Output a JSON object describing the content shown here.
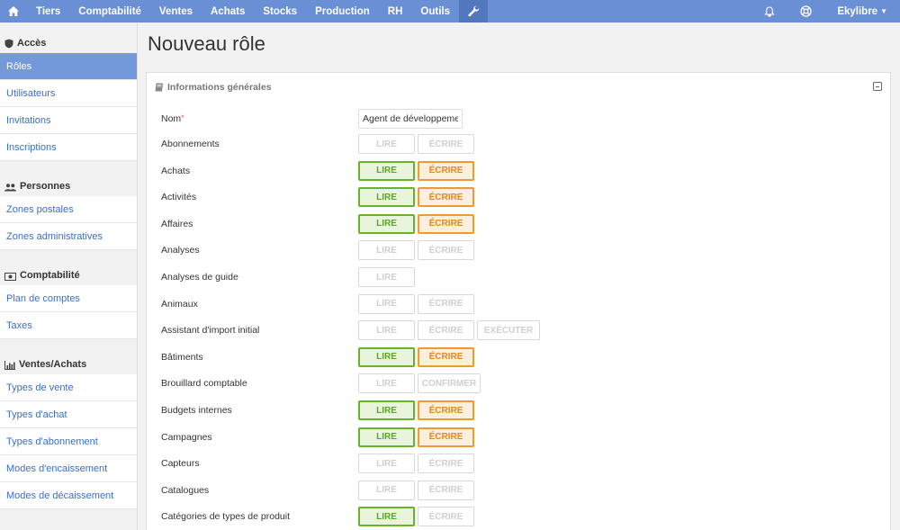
{
  "topnav": {
    "items": [
      "Tiers",
      "Comptabilité",
      "Ventes",
      "Achats",
      "Stocks",
      "Production",
      "RH",
      "Outils"
    ],
    "user": "Ekylibre"
  },
  "sidebar": {
    "sections": [
      {
        "title": "Accès",
        "icon": "shield-icon",
        "items": [
          "Rôles",
          "Utilisateurs",
          "Invitations",
          "Inscriptions"
        ]
      },
      {
        "title": "Personnes",
        "icon": "people-icon",
        "items": [
          "Zones postales",
          "Zones administratives"
        ]
      },
      {
        "title": "Comptabilité",
        "icon": "money-icon",
        "items": [
          "Plan de comptes",
          "Taxes"
        ]
      },
      {
        "title": "Ventes/Achats",
        "icon": "bar-chart-icon",
        "items": [
          "Types de vente",
          "Types d'achat",
          "Types d'abonnement",
          "Modes d'encaissement",
          "Modes de décaissement"
        ]
      }
    ]
  },
  "page": {
    "title": "Nouveau rôle"
  },
  "panel": {
    "title": "Informations générales",
    "name_label": "Nom",
    "name_required": "*",
    "name_value": "Agent de développement",
    "rows": [
      {
        "label": "Abonnements",
        "buttons": [
          {
            "text": "LIRE",
            "state": "off",
            "kind": "read"
          },
          {
            "text": "ÉCRIRE",
            "state": "off",
            "kind": "write"
          }
        ]
      },
      {
        "label": "Achats",
        "buttons": [
          {
            "text": "LIRE",
            "state": "on",
            "kind": "read"
          },
          {
            "text": "ÉCRIRE",
            "state": "on",
            "kind": "write"
          }
        ]
      },
      {
        "label": "Activités",
        "buttons": [
          {
            "text": "LIRE",
            "state": "on",
            "kind": "read"
          },
          {
            "text": "ÉCRIRE",
            "state": "on",
            "kind": "write"
          }
        ]
      },
      {
        "label": "Affaires",
        "buttons": [
          {
            "text": "LIRE",
            "state": "on",
            "kind": "read"
          },
          {
            "text": "ÉCRIRE",
            "state": "on",
            "kind": "write"
          }
        ]
      },
      {
        "label": "Analyses",
        "buttons": [
          {
            "text": "LIRE",
            "state": "off",
            "kind": "read"
          },
          {
            "text": "ÉCRIRE",
            "state": "off",
            "kind": "write"
          }
        ]
      },
      {
        "label": "Analyses de guide",
        "buttons": [
          {
            "text": "LIRE",
            "state": "off",
            "kind": "read"
          }
        ]
      },
      {
        "label": "Animaux",
        "buttons": [
          {
            "text": "LIRE",
            "state": "off",
            "kind": "read"
          },
          {
            "text": "ÉCRIRE",
            "state": "off",
            "kind": "write"
          }
        ]
      },
      {
        "label": "Assistant d'import initial",
        "buttons": [
          {
            "text": "LIRE",
            "state": "off",
            "kind": "read"
          },
          {
            "text": "ÉCRIRE",
            "state": "off",
            "kind": "write"
          },
          {
            "text": "EXÉCUTER",
            "state": "off",
            "kind": "execute"
          }
        ]
      },
      {
        "label": "Bâtiments",
        "buttons": [
          {
            "text": "LIRE",
            "state": "on",
            "kind": "read"
          },
          {
            "text": "ÉCRIRE",
            "state": "on",
            "kind": "write"
          }
        ]
      },
      {
        "label": "Brouillard comptable",
        "buttons": [
          {
            "text": "LIRE",
            "state": "off",
            "kind": "read"
          },
          {
            "text": "CONFIRMER",
            "state": "off",
            "kind": "confirm"
          }
        ]
      },
      {
        "label": "Budgets internes",
        "buttons": [
          {
            "text": "LIRE",
            "state": "on",
            "kind": "read"
          },
          {
            "text": "ÉCRIRE",
            "state": "on",
            "kind": "write"
          }
        ]
      },
      {
        "label": "Campagnes",
        "buttons": [
          {
            "text": "LIRE",
            "state": "on",
            "kind": "read"
          },
          {
            "text": "ÉCRIRE",
            "state": "on",
            "kind": "write"
          }
        ]
      },
      {
        "label": "Capteurs",
        "buttons": [
          {
            "text": "LIRE",
            "state": "off",
            "kind": "read"
          },
          {
            "text": "ÉCRIRE",
            "state": "off",
            "kind": "write"
          }
        ]
      },
      {
        "label": "Catalogues",
        "buttons": [
          {
            "text": "LIRE",
            "state": "off",
            "kind": "read"
          },
          {
            "text": "ÉCRIRE",
            "state": "off",
            "kind": "write"
          }
        ]
      },
      {
        "label": "Catégories de types de produit",
        "buttons": [
          {
            "text": "LIRE",
            "state": "on",
            "kind": "read"
          },
          {
            "text": "ÉCRIRE",
            "state": "off",
            "kind": "write"
          }
        ]
      }
    ]
  },
  "colors": {
    "nav": "#6a8fd4",
    "active": "#7499db",
    "read_on": "#67b32a",
    "write_on": "#ee9a33"
  }
}
